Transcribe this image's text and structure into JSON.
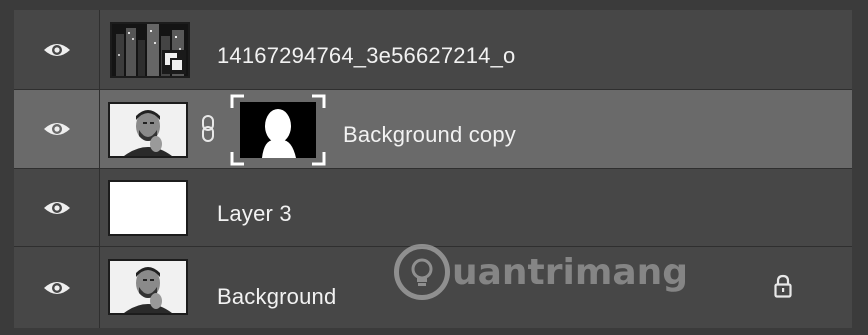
{
  "layers": [
    {
      "name": "14167294764_3e56627214_o",
      "visible": true,
      "selected": false,
      "thumbnail": "smart-object-city-photo"
    },
    {
      "name": "Background copy",
      "visible": true,
      "selected": true,
      "thumbnail": "portrait-photo",
      "mask": "head-silhouette-mask",
      "linked": true
    },
    {
      "name": "Layer 3",
      "visible": true,
      "selected": false,
      "thumbnail": "white-fill"
    },
    {
      "name": "Background",
      "visible": true,
      "selected": false,
      "thumbnail": "portrait-photo",
      "locked": true
    }
  ],
  "watermark": {
    "text": "uantrimang"
  },
  "icons": {
    "visibility": "eye-icon",
    "link": "chain-link-icon",
    "lock": "lock-icon",
    "smart_object": "smart-object-badge-icon"
  },
  "colors": {
    "panel_bg": "#474747",
    "selected_row_bg": "#6a6a6a",
    "text": "#f2f2f2"
  }
}
